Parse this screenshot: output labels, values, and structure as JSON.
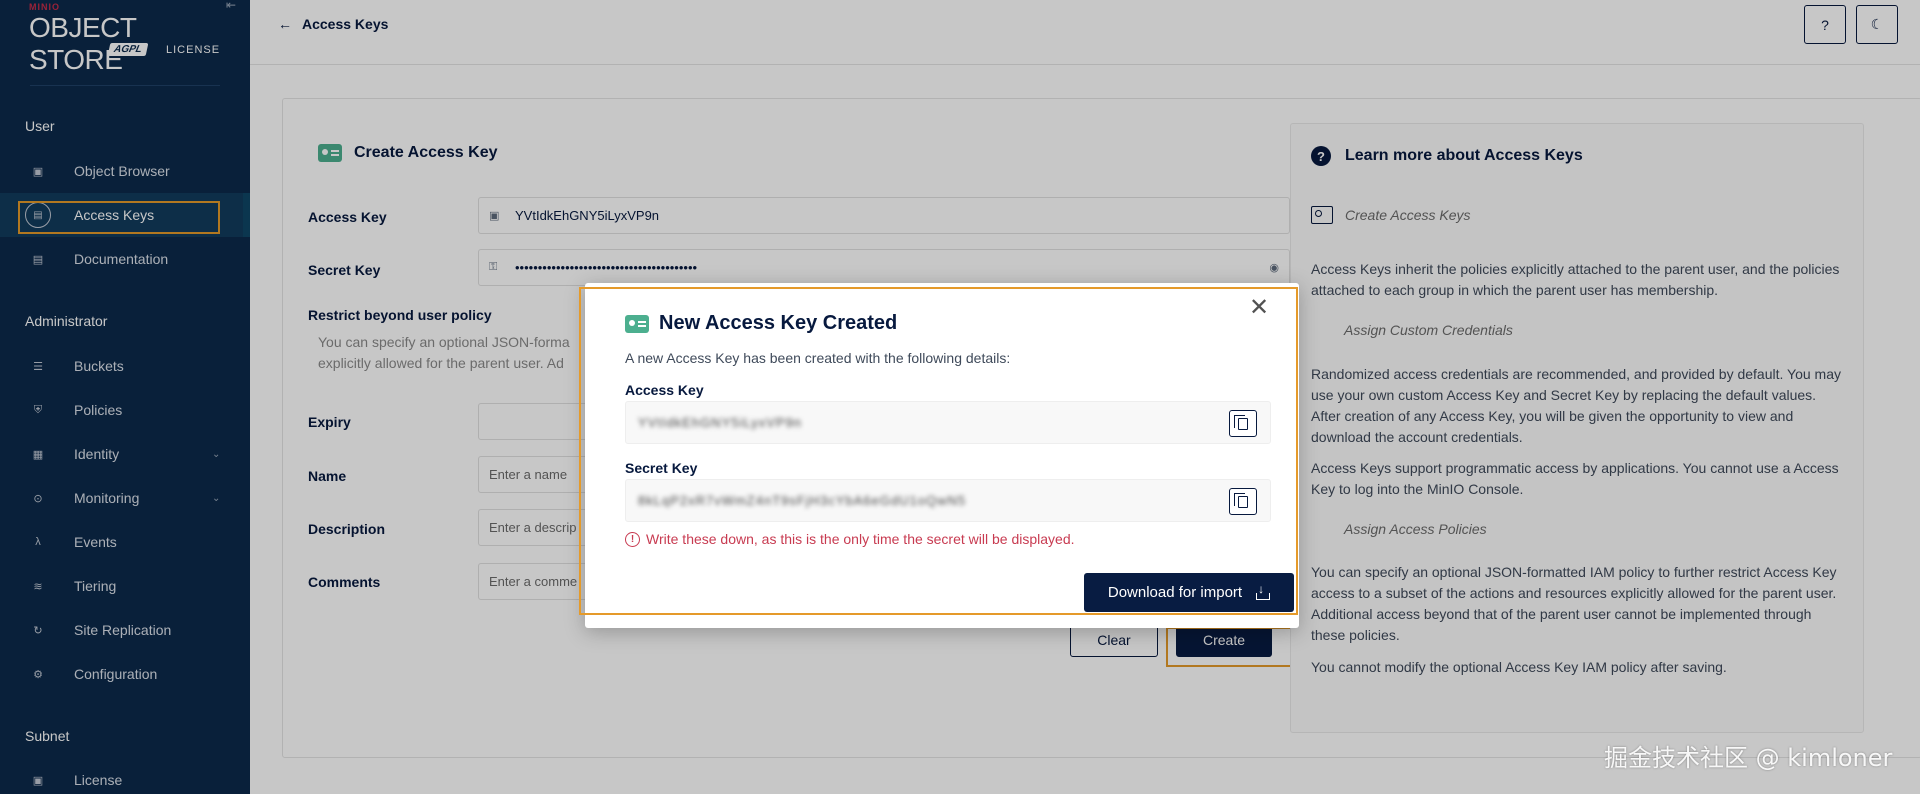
{
  "sidebar": {
    "brand": {
      "minio": "MINIO",
      "product": "OBJECT STORE",
      "edition": "AGPL",
      "license": "LICENSE"
    },
    "sections": {
      "user": "User",
      "administrator": "Administrator",
      "subnet": "Subnet"
    },
    "user_items": [
      {
        "label": "Object Browser",
        "icon": "object-browser-icon"
      },
      {
        "label": "Access Keys",
        "icon": "access-keys-icon",
        "active": true
      },
      {
        "label": "Documentation",
        "icon": "documentation-icon"
      }
    ],
    "admin_items": [
      {
        "label": "Buckets",
        "icon": "buckets-icon"
      },
      {
        "label": "Policies",
        "icon": "policies-icon"
      },
      {
        "label": "Identity",
        "icon": "identity-icon",
        "expandable": true
      },
      {
        "label": "Monitoring",
        "icon": "monitoring-icon",
        "expandable": true
      },
      {
        "label": "Events",
        "icon": "events-icon"
      },
      {
        "label": "Tiering",
        "icon": "tiering-icon"
      },
      {
        "label": "Site Replication",
        "icon": "site-replication-icon"
      },
      {
        "label": "Configuration",
        "icon": "configuration-icon"
      }
    ],
    "subnet_items": [
      {
        "label": "License",
        "icon": "license-icon"
      }
    ]
  },
  "header": {
    "back_label": "Access Keys",
    "help_icon": "question-icon",
    "theme_icon": "moon-icon"
  },
  "form": {
    "title": "Create Access Key",
    "access_key_label": "Access Key",
    "access_key_value": "YVtIdkEhGNY5iLyxVP9n",
    "secret_key_label": "Secret Key",
    "secret_key_value": "••••••••••••••••••••••••••••••••••••••••",
    "restrict_label": "Restrict beyond user policy",
    "restrict_desc_1": "You can specify an optional JSON-forma",
    "restrict_desc_2": "explicitly allowed for the parent user. Ad",
    "expiry_label": "Expiry",
    "name_label": "Name",
    "name_placeholder": "Enter a name",
    "description_label": "Description",
    "description_placeholder": "Enter a descrip",
    "comments_label": "Comments",
    "comments_placeholder": "Enter a comme",
    "clear_label": "Clear",
    "create_label": "Create"
  },
  "help": {
    "title": "Learn more about Access Keys",
    "create_heading": "Create Access Keys",
    "p1": "Access Keys inherit the policies explicitly attached to the parent user, and the policies attached to each group in which the parent user has membership.",
    "custom_heading": "Assign Custom Credentials",
    "p2": "Randomized access credentials are recommended, and provided by default. You may use your own custom Access Key and Secret Key by replacing the default values. After creation of any Access Key, you will be given the opportunity to view and download the account credentials.",
    "p3": "Access Keys support programmatic access by applications. You cannot use a Access Key to log into the MinIO Console.",
    "policies_heading": "Assign Access Policies",
    "p4": "You can specify an optional JSON-formatted IAM policy to further restrict Access Key access to a subset of the actions and resources explicitly allowed for the parent user. Additional access beyond that of the parent user cannot be implemented through these policies.",
    "p5": "You cannot modify the optional Access Key IAM policy after saving."
  },
  "modal": {
    "title": "New Access Key Created",
    "description": "A new Access Key has been created with the following details:",
    "access_key_label": "Access Key",
    "access_key_value": "YVtIdkEhGNY5iLyxVP9n",
    "secret_key_label": "Secret Key",
    "secret_key_value": "8kLqP2xR7vWmZ4nT9sFjH3cYbA6eGdU1oQwN5",
    "warning": "Write these down, as this is the only time the secret will be displayed.",
    "download_label": "Download for import"
  },
  "watermark": "掘金技术社区 @ kimloner",
  "colors": {
    "sidebar_bg": "#0c2a4b",
    "primary": "#081c42",
    "warning": "#c83b51",
    "highlight_outline": "#e59a2a"
  }
}
